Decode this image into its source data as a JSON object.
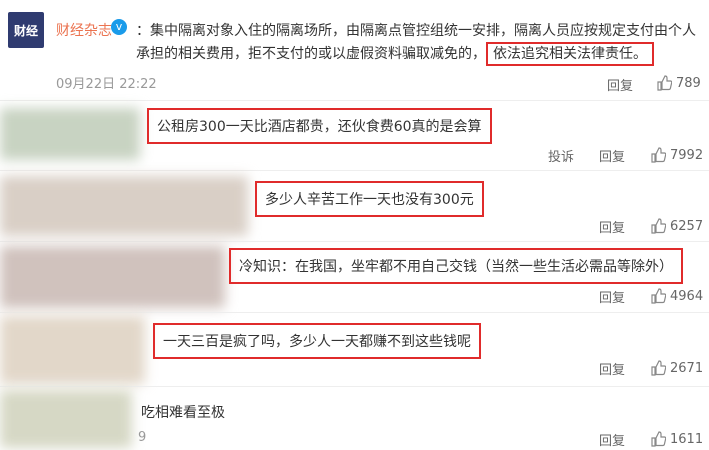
{
  "post": {
    "avatar_text": "财经",
    "author": "财经杂志",
    "verified_icon": "v",
    "text_main": "：集中隔离对象入住的隔离场所，由隔离点管控组统一安排，隔离人员应按规定支付由个人承担的相关费用，拒不支付的或以虚假资料骗取减免的，",
    "text_highlight": "依法追究相关法律责任。",
    "time": "09月22日 22:22",
    "reply_label": "回复",
    "likes": "789"
  },
  "comments": [
    {
      "text": "公租房300一天比酒店都贵，还伙食费60真的是会算",
      "report_label": "投诉",
      "reply_label": "回复",
      "likes": "7992"
    },
    {
      "text": "多少人辛苦工作一天也没有300元",
      "reply_label": "回复",
      "likes": "6257"
    },
    {
      "text": "冷知识：在我国，坐牢都不用自己交钱（当然一些生活必需品等除外）",
      "reply_label": "回复",
      "likes": "4964"
    },
    {
      "text": "一天三百是疯了吗，多少人一天都赚不到这些钱呢",
      "reply_label": "回复",
      "likes": "2671"
    },
    {
      "text": "吃相难看至极",
      "fragment": "9",
      "reply_label": "回复",
      "likes": "1611"
    }
  ],
  "colors": {
    "highlight_border": "#e02b2b",
    "author": "#eb7350",
    "verify": "#1a9bea"
  }
}
